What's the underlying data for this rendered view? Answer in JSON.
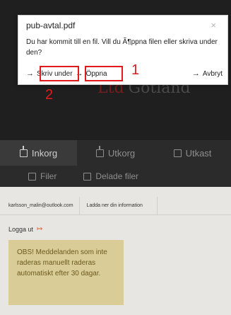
{
  "brand": {
    "accent": "Ltd",
    "name": "Gotland"
  },
  "nav": {
    "tabs": [
      {
        "label": "Inkorg",
        "icon": "inbox-icon"
      },
      {
        "label": "Utkorg",
        "icon": "outbox-icon"
      },
      {
        "label": "Utkast",
        "icon": "draft-icon"
      }
    ],
    "tabs2": [
      {
        "label": "Filer",
        "icon": "file-icon"
      },
      {
        "label": "Delade filer",
        "icon": "shared-file-icon"
      }
    ]
  },
  "user": {
    "email": "karlsson_malin@outlook.com",
    "download": "Ladda ner din information",
    "logout": "Logga ut",
    "logout_icon": "logout-arrow-icon"
  },
  "notice": "OBS! Meddelanden som inte raderas manuellt raderas automatiskt efter 30 dagar.",
  "popup": {
    "title": "pub-avtal.pdf",
    "close": "×",
    "message": "Du har kommit till en fil. Vill du Ã¶ppna filen eller skriva under den?",
    "sign": "Skriv under",
    "open": "Öppna",
    "cancel": "Avbryt"
  },
  "markers": {
    "one": "1",
    "two": "2"
  },
  "colors": {
    "highlight": "#e01b1b",
    "notice_bg": "#d9cc96",
    "header_bg": "#1f1f1f"
  }
}
